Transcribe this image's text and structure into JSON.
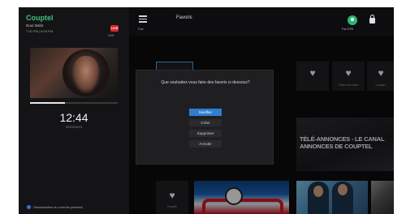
{
  "left_panel": {
    "brand": "Couptel",
    "channel_name": "Nour Bahir",
    "program_time": "7:00 PM | 8:59 PM",
    "live_badge": "LIVE",
    "status_label": "LIVE",
    "progress": 0.4,
    "clock": "12:44",
    "date": "2020/03/13",
    "parental_text": "Désactivation du contrôle parental"
  },
  "topbar": {
    "menu_label": "Fav",
    "title": "Favoris",
    "profile_label": "Fav DTB"
  },
  "grid": {
    "favorite_labels": [
      "Vidéo à la carte",
      "Couptel",
      "Rec"
    ],
    "banner_text": "TÉLÉ-ANNONCES - LE CANAL ANNONCES DE COUPTEL",
    "bottom_label": "Couptel"
  },
  "dialog": {
    "question": "Que souhaitez-vous faire des favoris ci-dessous?",
    "options": [
      "Modifier",
      "Créer",
      "Supprimer",
      "Annuler"
    ],
    "selected_index": 0
  },
  "colors": {
    "accent_blue": "#2f7fd1",
    "brand_green": "#3fc07a",
    "live_red": "#d9262c"
  }
}
